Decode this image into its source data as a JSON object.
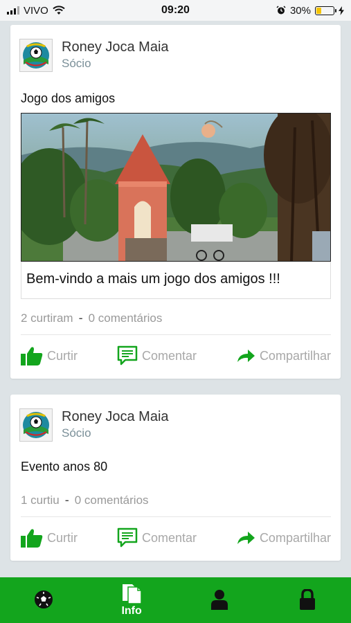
{
  "status_bar": {
    "carrier": "VIVO",
    "time": "09:20",
    "battery": "30%",
    "battery_level": 0.3
  },
  "posts": [
    {
      "author": "Roney Joca Maia",
      "role": "Sócio",
      "title": "Jogo dos amigos",
      "has_image": true,
      "caption": "Bem-vindo a mais um jogo dos amigos !!!",
      "likes": "2 curtiram",
      "comments": "0 comentários"
    },
    {
      "author": "Roney Joca Maia",
      "role": "Sócio",
      "title": "Evento anos 80",
      "has_image": false,
      "likes": "1 curtiu",
      "comments": "0 comentários"
    }
  ],
  "actions": {
    "like": "Curtir",
    "comment": "Comentar",
    "share": "Compartilhar"
  },
  "tabbar": {
    "tabs": [
      {
        "icon": "soccer-ball-icon",
        "label": ""
      },
      {
        "icon": "document-icon",
        "label": "Info",
        "active": true
      },
      {
        "icon": "person-icon",
        "label": ""
      },
      {
        "icon": "lock-icon",
        "label": ""
      }
    ]
  },
  "colors": {
    "accent": "#13a51d",
    "action_text": "#a8a8a8",
    "role_text": "#7a8f98",
    "background": "#dde3e6"
  }
}
